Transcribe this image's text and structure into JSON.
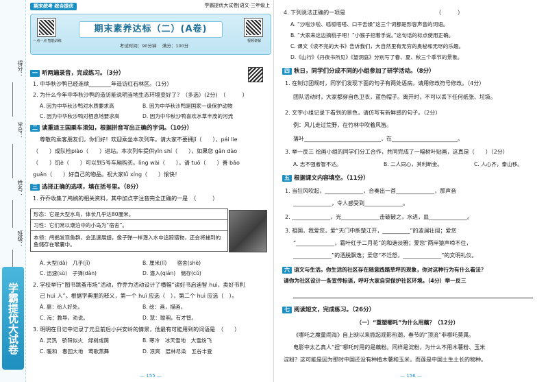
{
  "strip": {
    "score": "得分：",
    "student_id": "学号：",
    "name": "姓名：",
    "class": "班级：",
    "logo": "学霸提优大试卷"
  },
  "header": {
    "series": "期末统考 综合提优",
    "series_right": "学霸提优大试卷|语文·三年级上"
  },
  "banner": {
    "title": "期末素养达标（二）(A卷)",
    "qr_left_caption": "一点一点 智能训练",
    "qr_right_caption": "视频讲解",
    "time": "考试时间：90分钟",
    "score": "满分：100分"
  },
  "left": {
    "s1": {
      "num": "一",
      "title": "听两遍录音，完成练习。（3分）"
    },
    "s1q1": "1. 中华秋沙鸭已经连续________年造访红石林区。（1分）",
    "s1q2": "2. 为什么今年中华秋沙鸭的造访能说明当地生态环境变好了？（多选）(2分)　（　　　）",
    "s1q2a": "A. 因为中华秋沙鸭对水质要求高",
    "s1q2b": "B. 因为中华秋沙鸭是国家一级保护动物",
    "s1q2c": "C. 因为中华秋沙鸭对栖息地要求高",
    "s1q2d": "D. 因为中华秋沙鸭喜欢水草丰茂的河流",
    "s2": {
      "num": "二",
      "title": "读重适王国乘车须知，根据拼音写出正确的字词。（10分）"
    },
    "s2p1": "尊敬的乘客朋友们，你们好！欢迎乘坐本次列车。请大家不要拥jǐ（　　），pái lie",
    "s2p2": "（　　）成队检piào（　　）进站。本次列车提供yǐn shí（　　），如果您 gǎn dào",
    "s2p3": "（　　）饥è（　　）可以到5号车厢购买。lìng wài（　　），请 tuō（　　）善 bǎo",
    "s2p4": "guǎn（　　）好自己的物品。祝大家lǚ xíng（　　）愉快！",
    "s3": {
      "num": "三",
      "title": "选择正确的选项，填在括号里。（8分）"
    },
    "s3q1": "1. 乔乔收集了鸬鹚的相关资料，其中加点字注音完全正确的一是　（　　　）",
    "table": [
      "形态：它是大型水鸟，体长几乎达80厘米。",
      "习性：它们常以潮泊中的小岛为“宿舍”。",
      "本领：鸬鹚发现鱼群，会迅速展翅，像子弹一样潜入水中追踪猎物，还会将捕到的鱼储存在喉囊中。"
    ],
    "s3q1a": "A. 大型(dà)　几乎(jǐ)",
    "s3q1b": "B. 厘米(lí)　　宿舍(shè)",
    "s3q1c": "C. 迅速(sù)　子弹(dàn)",
    "s3q1d": "D. 潜入(qián)　储存(cǔ)",
    "s3q2": "2. 学校举行“图书跳蚤市场”活动，乔乔为活动设计了横幅“读好书启迪智 huì，卖好书利",
    "s3q2b": "己 huì 人”。根据字典里的释义，第一个 huì 应选（　），第二个 huì 应选（　）。",
    "s3q2a1": "A. 惠：给人好处。",
    "s3q2a2": "B. 绘：画，描画。",
    "s3q2a3": "C. 海：教导，劝说。",
    "s3q2a4": "D. 慧：聪明，有才智。",
    "s3q3": "3. 明明在日记中记录了元旦前后小兴安岭的情景，他最有可能用到的词语是　（　　）",
    "s3q3a": "A. 灵热　骄阳似火　绿树成荫",
    "s3q3b": "B. 寒冷　冰天雪地　大雪纷飞",
    "s3q3c": "C. 暖和　春回大地　莺歌燕舞",
    "s3q3d": "D. 凉爽　层林尽染　五谷丰登",
    "page_no": "— 155 —"
  },
  "right": {
    "q4": "4. 下列说法正确的一项是　　　　　　　　　　　　　　　　　（　　　）",
    "q4a": "A. “沙啦沙啦、呱呱嗒嗒、口干舌燥”这三个词都是形容声音的词语。",
    "q4b": "B. “大家来这边搞桃子吧！”小猴子招着手说。”这句话的标点使用正确。",
    "q4c": "C. 课文《读不完的大书》告诉我们，大自然里有无穷的奥秘和无尽的乐趣。",
    "q4d": "D.《山行》《丹夜书所见》《望洞庭》分别写了春、夏、秋三个季节的景象。",
    "s4": {
      "num": "四",
      "title": "秋日，同学们分成不同的小组参加了研学活动。（8分）"
    },
    "s4q1": "1. 在制订团规时，同学们发现下面的句子有两处语病，请用修改符号修改。（4分）",
    "s4q1s": "团队活动时，大家都穿自色卫衣，蓝色帽子。离开时，不可以丢下任何纸张、垃圾。",
    "s4q2": "2. 文字小组记录下看到的景色，请仿写有新鲜感的句子。（2分）",
    "s4q2e": "例：风儿走过荒野，在竹林中吹着风笛。",
    "s4q2l": "落叶____________________________，在________________________。",
    "s4q3": "3. 举一反三 绘画小组的同学们分工合作，共同完成了一幅树叶贴画，这真是（　　）（2分）",
    "s4q3a": "A. 志不强者智不达。",
    "s4q3b": "B. 二人同心，其利断金。",
    "s4q3c": "C. 人心齐，泰山移。",
    "s5": {
      "num": "五",
      "title": "根据课文内容填空。（11分）"
    },
    "s5q1": "1. 当狂风吹起，______________，合奏出一首______________，那声音",
    "s5q1b": "______________，令人感受到______________。",
    "s5q2": "2. ______________，光______________击破破之，水进，皿______________。",
    "s5q3": "3. 祖国，我爱您，爱“天门中断楚江开，__________”的波澜壮阔；爱您",
    "s5q3b": "“______________，霜叶红于二月花”的和谐淡雅；爱您“两岸猿声啼不住，",
    "s5q3c": "______________”的洒脱飘逸；爱您“不迁怒，______________”的文明礼仪。",
    "s6": {
      "num": "六",
      "title": "语文与生活。你生活的社区存在随意践踏草坪的现象，你对这种行为有什么看法？"
    },
    "s6b": "请你为社区设计一条宣传标语，呼吁大家自觉保护社区环境。（4分）举一反三",
    "s7": {
      "num": "七",
      "title": "阅读短文，完成练习。（26分）"
    },
    "s7h": "（一）“重塑哪吒”为什么用藕？（12分）",
    "s7p1": "《哪吒之魔童闹海》自上映以来掀起观影热潮，春节的“顶流”非哪吒莫属。",
    "s7p2": "电影中太乙真人“捏”哪吒时用的是藕粉。同样是淀粉，为什么不用木薯粉、玉米",
    "s7p3": "淀粉？这可能是因为那时中国还没有种植木薯和玉米，而莲是中国土生土长的物种。",
    "page_no": "— 156 —"
  }
}
